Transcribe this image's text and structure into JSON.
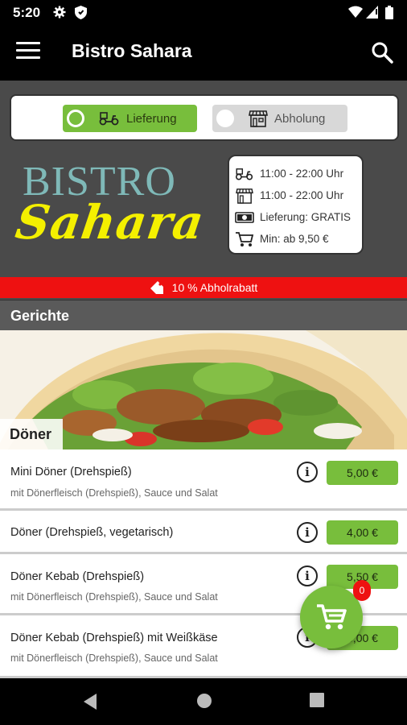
{
  "status_bar": {
    "time": "5:20",
    "icons": [
      "gear-icon",
      "shield-icon",
      "wifi-icon",
      "signal-icon",
      "battery-icon"
    ]
  },
  "app_bar": {
    "title": "Bistro Sahara",
    "menu_icon": "hamburger-icon",
    "search_icon": "search-icon"
  },
  "order_mode": {
    "delivery_label": "Lieferung",
    "pickup_label": "Abholung",
    "selected": "delivery"
  },
  "logo": {
    "line1": "BISTRO",
    "line2": "Sahara"
  },
  "info": {
    "delivery_hours": "11:00 - 22:00 Uhr",
    "pickup_hours": "11:00 - 22:00 Uhr",
    "delivery_fee": "Lieferung: GRATIS",
    "minimum": "Min: ab 9,50 €"
  },
  "promo": {
    "text": "10 % Abholrabatt"
  },
  "section": {
    "title": "Gerichte"
  },
  "category": {
    "label": "Döner"
  },
  "menu_items": [
    {
      "name": "Mini Döner (Drehspieß)",
      "description": "mit Dönerfleisch (Drehspieß), Sauce und Salat",
      "price": "5,00 €"
    },
    {
      "name": "Döner (Drehspieß, vegetarisch)",
      "description": "",
      "price": "4,00 €"
    },
    {
      "name": "Döner Kebab (Drehspieß)",
      "description": "mit Dönerfleisch (Drehspieß), Sauce und Salat",
      "price": "5,50 €"
    },
    {
      "name": "Döner Kebab (Drehspieß) mit Weißkäse",
      "description": "mit Dönerfleisch (Drehspieß), Sauce und Salat",
      "price": "6,00 €"
    }
  ],
  "cart": {
    "count": "0"
  },
  "colors": {
    "accent_green": "#78be3c",
    "promo_red": "#ee1111",
    "logo_teal": "#7fb9b8",
    "logo_yellow": "#f4f000"
  }
}
